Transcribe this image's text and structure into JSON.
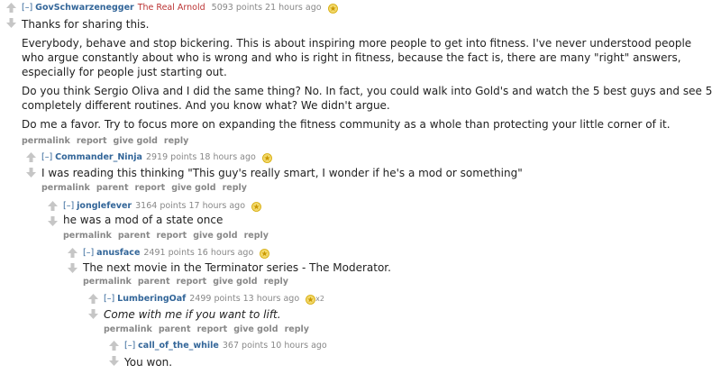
{
  "comments": [
    {
      "collapse": "[–]",
      "author": "GovSchwarzenegger",
      "flair": "The Real Arnold",
      "score": "5093 points",
      "time": "21 hours ago",
      "paragraphs": [
        "Thanks for sharing this.",
        "Everybody, behave and stop bickering. This is about inspiring more people to get into fitness. I've never understood people who argue constantly about who is wrong and who is right in fitness, because the fact is, there are many \"right\" answers, especially for people just starting out.",
        "Do you think Sergio Oliva and I did the same thing? No. In fact, you could walk into Gold's and watch the 5 best guys and see 5 completely different routines. And you know what? We didn't argue.",
        "Do me a favor. Try to focus more on expanding the fitness community as a whole than protecting your little corner of it."
      ],
      "buttons": [
        "permalink",
        "report",
        "give gold",
        "reply"
      ]
    },
    {
      "collapse": "[–]",
      "author": "Commander_Ninja",
      "score": "2919 points",
      "time": "18 hours ago",
      "paragraphs": [
        "I was reading this thinking \"This guy's really smart, I wonder if he's a mod or something\""
      ],
      "buttons": [
        "permalink",
        "parent",
        "report",
        "give gold",
        "reply"
      ]
    },
    {
      "collapse": "[–]",
      "author": "jonglefever",
      "score": "3164 points",
      "time": "17 hours ago",
      "paragraphs": [
        "he was a mod of a state once"
      ],
      "buttons": [
        "permalink",
        "parent",
        "report",
        "give gold",
        "reply"
      ]
    },
    {
      "collapse": "[–]",
      "author": "anusface",
      "score": "2491 points",
      "time": "16 hours ago",
      "paragraphs": [
        "The next movie in the Terminator series - The Moderator."
      ],
      "buttons": [
        "permalink",
        "parent",
        "report",
        "give gold",
        "reply"
      ]
    },
    {
      "collapse": "[–]",
      "author": "LumberingOaf",
      "score": "2499 points",
      "time": "13 hours ago",
      "gild_count": "x2",
      "paragraphs": [
        "Come with me if you want to lift."
      ],
      "buttons": [
        "permalink",
        "parent",
        "report",
        "give gold",
        "reply"
      ]
    },
    {
      "collapse": "[–]",
      "author": "call_of_the_while",
      "score": "367 points",
      "time": "10 hours ago",
      "paragraphs": [
        "You won."
      ],
      "buttons": []
    }
  ],
  "colors": {
    "author": "#336699",
    "flair": "#bb3333",
    "meta": "#888888",
    "gold": "#e6b800"
  },
  "icons": {
    "upvote": "up-arrow-icon",
    "downvote": "down-arrow-icon",
    "gilded": "gold-star-icon"
  }
}
